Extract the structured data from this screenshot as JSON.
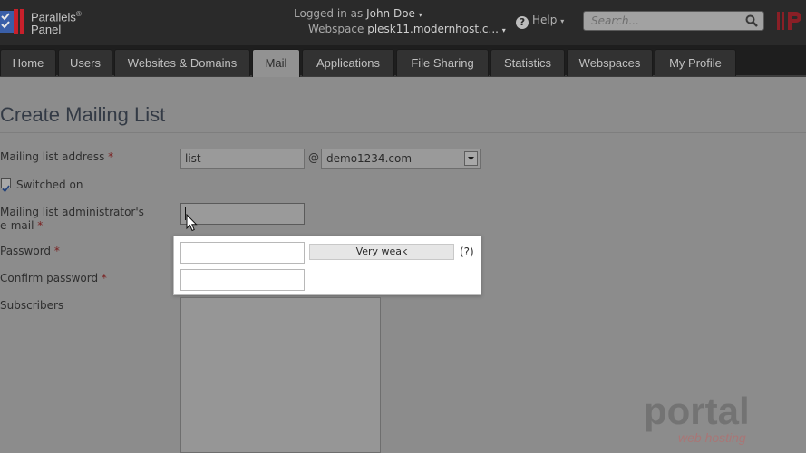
{
  "brand": {
    "line1": "Parallels",
    "line2": "Panel",
    "reg": "®"
  },
  "header": {
    "logged_in_label": "Logged in as",
    "user_name": "John Doe",
    "webspace_label": "Webspace",
    "webspace_value": "plesk11.modernhost.c...",
    "help_label": "Help",
    "search_placeholder": "Search..."
  },
  "nav": {
    "tabs": [
      {
        "label": "Home",
        "active": false
      },
      {
        "label": "Users",
        "active": false
      },
      {
        "label": "Websites & Domains",
        "active": false
      },
      {
        "label": "Mail",
        "active": true
      },
      {
        "label": "Applications",
        "active": false
      },
      {
        "label": "File Sharing",
        "active": false
      },
      {
        "label": "Statistics",
        "active": false
      },
      {
        "label": "Webspaces",
        "active": false
      },
      {
        "label": "My Profile",
        "active": false
      }
    ]
  },
  "page": {
    "title": "Create Mailing List"
  },
  "form": {
    "address_label": "Mailing list address",
    "address_value": "list",
    "at_sign": "@",
    "domain_value": "demo1234.com",
    "switched_on_label": "Switched on",
    "switched_on_checked": true,
    "admin_email_label_1": "Mailing list administrator's",
    "admin_email_label_2": "e-mail",
    "admin_email_value": "",
    "password_label": "Password",
    "password_strength": "Very weak",
    "password_hint": "(?)",
    "confirm_label": "Confirm password",
    "subscribers_label": "Subscribers",
    "required_mark": "*"
  },
  "watermark": {
    "line1": "portal",
    "line2": "web hosting"
  },
  "colors": {
    "topbar": "#2a2a2a",
    "active_tab": "#929292",
    "page_bg": "#8c8c8c",
    "required": "#7a2020"
  }
}
